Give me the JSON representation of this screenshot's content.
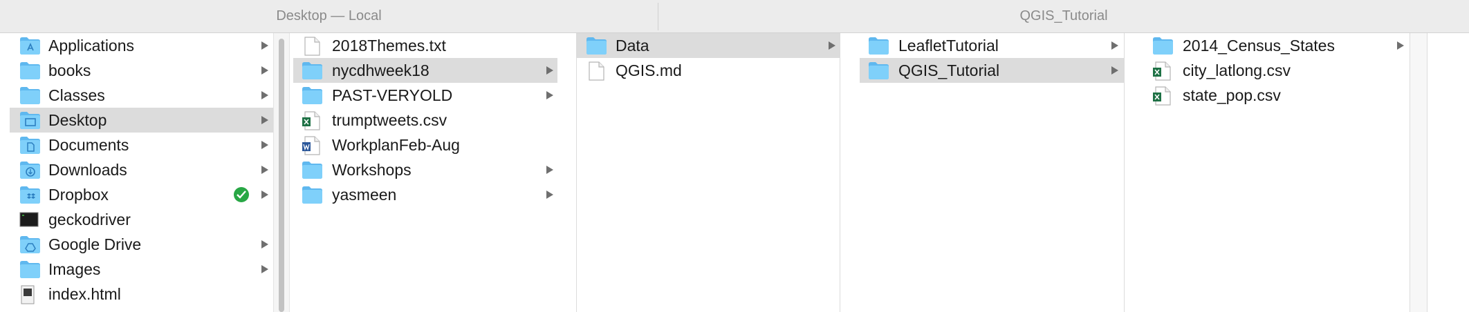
{
  "header": {
    "left_title": "Desktop — Local",
    "right_title": "QGIS_Tutorial"
  },
  "sidebar": {
    "items": [
      {
        "label": "Applications",
        "icon": "applications-folder-icon"
      },
      {
        "label": "books",
        "icon": "folder-icon"
      },
      {
        "label": "Classes",
        "icon": "folder-icon"
      },
      {
        "label": "Desktop",
        "icon": "desktop-folder-icon",
        "selected": true
      },
      {
        "label": "Documents",
        "icon": "documents-folder-icon"
      },
      {
        "label": "Downloads",
        "icon": "downloads-folder-icon"
      },
      {
        "label": "Dropbox",
        "icon": "dropbox-folder-icon",
        "badge": "sync-complete-icon"
      },
      {
        "label": "geckodriver",
        "icon": "terminal-executable-icon"
      },
      {
        "label": "Google Drive",
        "icon": "google-drive-folder-icon"
      },
      {
        "label": "Images",
        "icon": "folder-icon"
      },
      {
        "label": "index.html",
        "icon": "html-file-icon"
      }
    ]
  },
  "column1": {
    "items": [
      {
        "label": "2018Themes.txt",
        "icon": "text-file-icon"
      },
      {
        "label": "nycdhweek18",
        "icon": "folder-icon",
        "selected": true
      },
      {
        "label": "PAST-VERYOLD",
        "icon": "folder-icon"
      },
      {
        "label": "trumptweets.csv",
        "icon": "excel-csv-icon"
      },
      {
        "label": "WorkplanFeb-Aug",
        "icon": "word-document-icon"
      },
      {
        "label": "Workshops",
        "icon": "folder-icon"
      },
      {
        "label": "yasmeen",
        "icon": "folder-icon"
      }
    ]
  },
  "column2": {
    "items": [
      {
        "label": "Data",
        "icon": "folder-icon",
        "selected": true
      },
      {
        "label": "QGIS.md",
        "icon": "blank-file-icon"
      }
    ]
  },
  "column3": {
    "items": [
      {
        "label": "LeafletTutorial",
        "icon": "folder-icon"
      },
      {
        "label": "QGIS_Tutorial",
        "icon": "folder-icon",
        "selected": true
      }
    ]
  },
  "column4": {
    "items": [
      {
        "label": "2014_Census_States",
        "icon": "folder-icon"
      },
      {
        "label": "city_latlong.csv",
        "icon": "excel-csv-icon"
      },
      {
        "label": "state_pop.csv",
        "icon": "excel-csv-icon"
      }
    ]
  },
  "colors": {
    "folder_blue": "#6ec6f5",
    "selection_gray": "#dcdcdc",
    "sync_green": "#28a745"
  }
}
